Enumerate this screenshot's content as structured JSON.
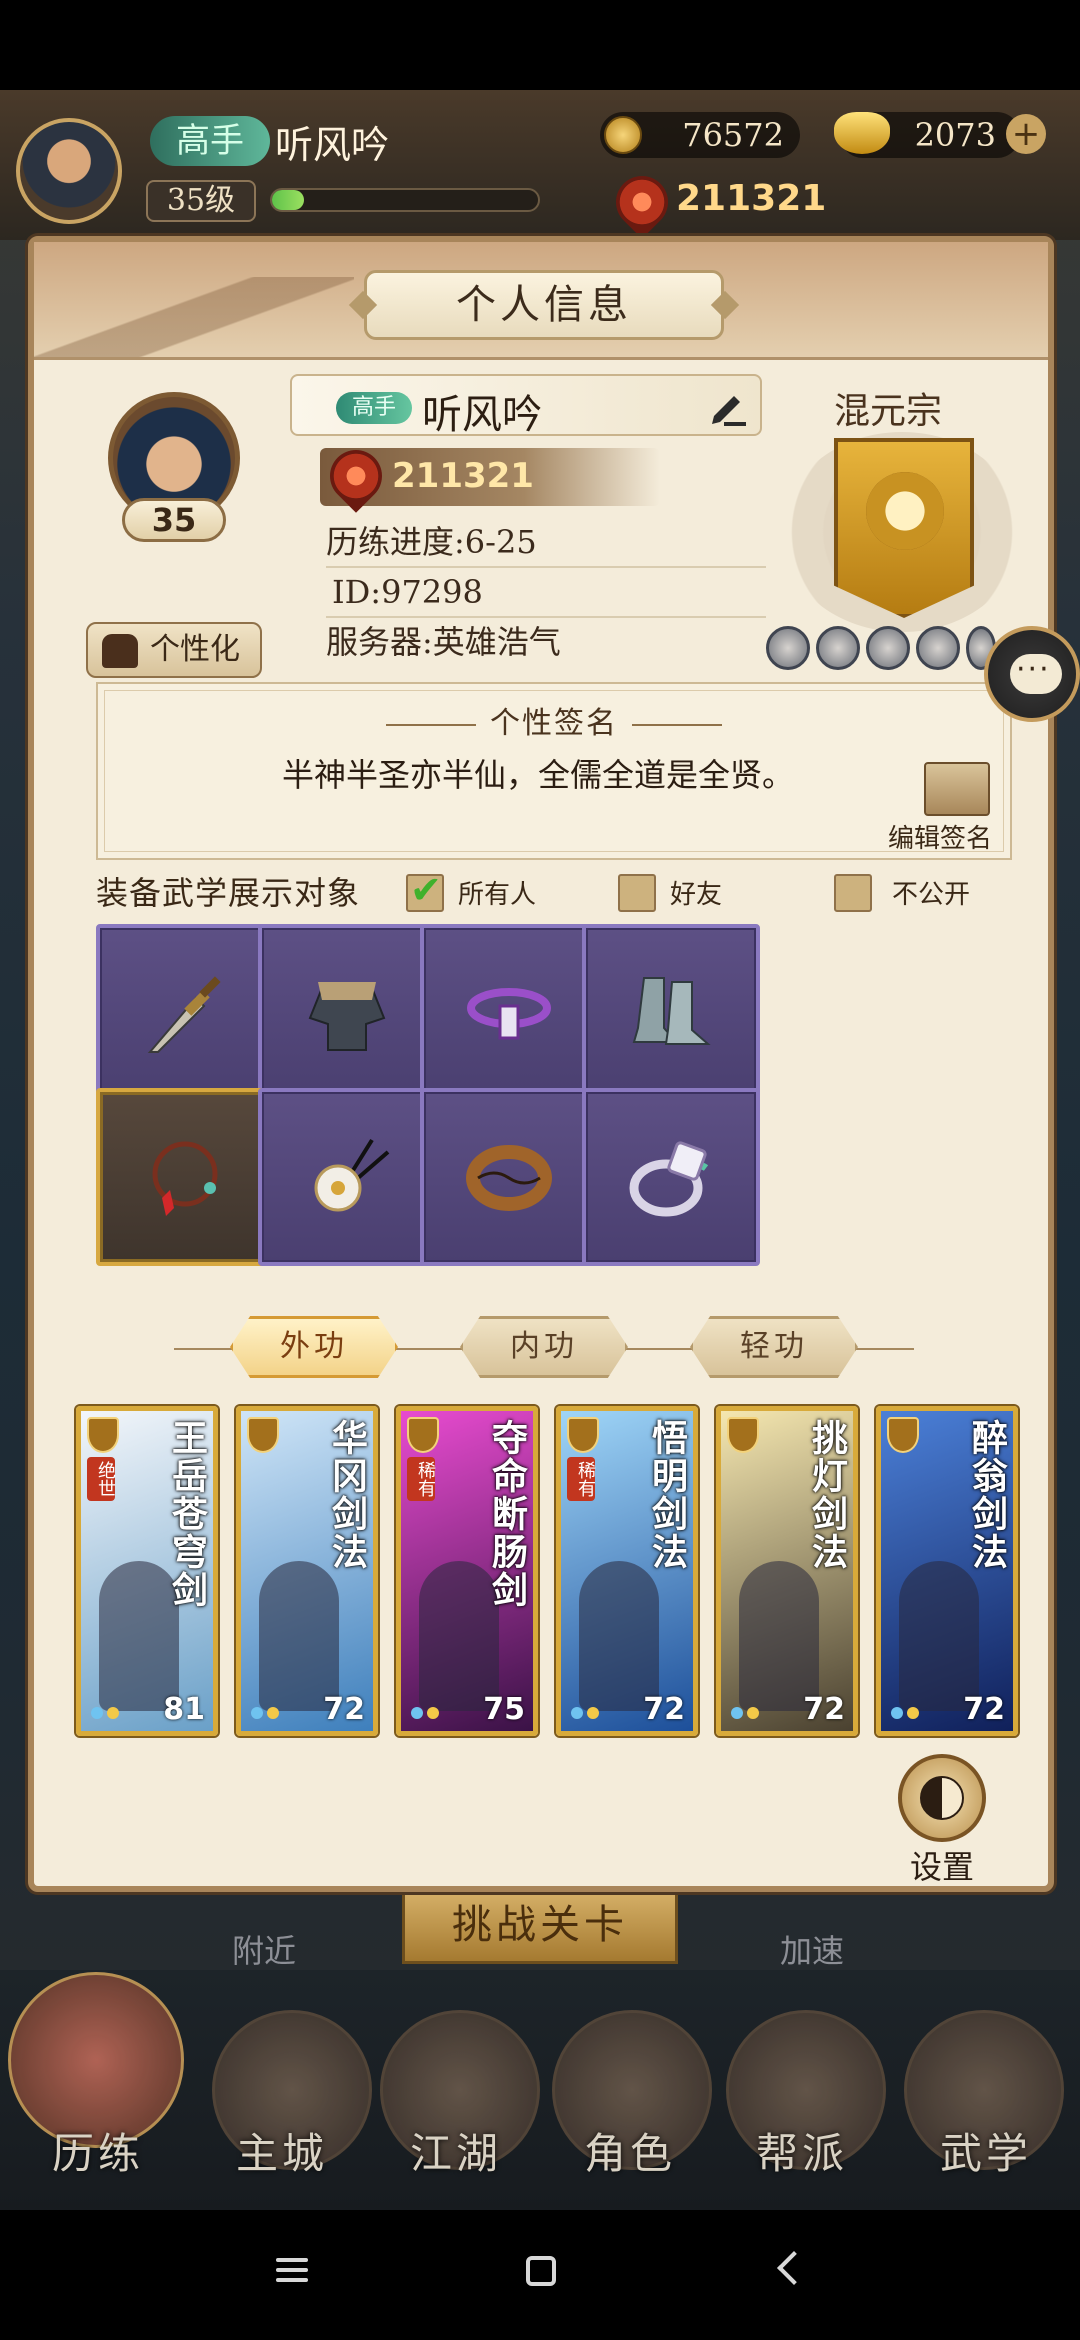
{
  "hud": {
    "rank": "高手",
    "name": "听风吟",
    "level": "35级",
    "exp_progress": 0.12,
    "coins": "76572",
    "ingots": "2073",
    "power": "211321"
  },
  "panel": {
    "title": "个人信息",
    "avatar_level": "35",
    "personalize_label": "个性化",
    "name_rank": "高手",
    "name": "听风吟",
    "power": "211321",
    "progress": "历练进度:6-25",
    "id": "ID:97298",
    "server": "服务器:英雄浩气",
    "sect": "混元宗",
    "signature_title": "个性签名",
    "signature": "半神半圣亦半仙，全儒全道是全贤。",
    "edit_signature_label": "编辑签名",
    "display_label": "装备武学展示对象",
    "visibility": [
      {
        "label": "所有人",
        "checked": true
      },
      {
        "label": "好友",
        "checked": false
      },
      {
        "label": "不公开",
        "checked": false
      }
    ],
    "equipment": [
      {
        "icon": "sword-icon"
      },
      {
        "icon": "armor-icon"
      },
      {
        "icon": "belt-icon"
      },
      {
        "icon": "boots-icon"
      },
      {
        "icon": "bracelet-icon",
        "gold": true
      },
      {
        "icon": "hairpin-icon"
      },
      {
        "icon": "bangle-icon"
      },
      {
        "icon": "ring-icon"
      }
    ],
    "tabs": [
      {
        "label": "外功",
        "active": true
      },
      {
        "label": "内功",
        "active": false
      },
      {
        "label": "轻功",
        "active": false
      }
    ],
    "skills": [
      {
        "title": "王岳苍穹剑",
        "tag": "绝世",
        "level": "81",
        "colors": [
          "#f3f6fa",
          "#6aa0c8"
        ]
      },
      {
        "title": "华冈剑法",
        "tag": "",
        "level": "72",
        "colors": [
          "#cfe5f7",
          "#3e7fbc"
        ]
      },
      {
        "title": "夺命断肠剑",
        "tag": "稀有",
        "level": "75",
        "colors": [
          "#e84bd0",
          "#3a1246"
        ]
      },
      {
        "title": "悟明剑法",
        "tag": "稀有",
        "level": "72",
        "colors": [
          "#9fd5f7",
          "#1d4f9a"
        ]
      },
      {
        "title": "挑灯剑法",
        "tag": "",
        "level": "72",
        "colors": [
          "#f5e7b0",
          "#4a4130"
        ]
      },
      {
        "title": "醉翁剑法",
        "tag": "",
        "level": "72",
        "colors": [
          "#4b80d8",
          "#10205a"
        ]
      }
    ],
    "settings_label": "设置"
  },
  "bottom": {
    "nearby": "附近",
    "challenge": "挑战关卡",
    "speedup": "加速",
    "nav": [
      "历练",
      "主城",
      "江湖",
      "角色",
      "帮派",
      "武学"
    ]
  }
}
